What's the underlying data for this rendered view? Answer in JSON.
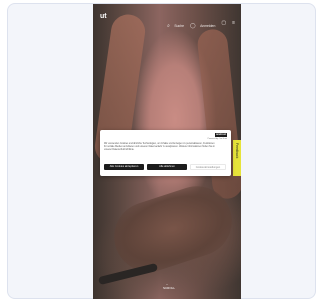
{
  "header": {
    "logo_text": "ut",
    "nav": [
      {
        "icon": "search-icon",
        "glyph": "⌕",
        "label": "Suche"
      },
      {
        "icon": "user-icon",
        "glyph": "◯",
        "label": "Anmelden"
      },
      {
        "icon": "cart-icon",
        "glyph": "▢",
        "label": ""
      },
      {
        "icon": "menu-icon",
        "glyph": "≡",
        "label": ""
      }
    ]
  },
  "side_tab": {
    "label": "Feedback"
  },
  "cookie_dialog": {
    "badge": "onetrust",
    "sub": "Powered by OneTrust",
    "text": "Wir verwenden Cookies und ähnliche Technologien, um Inhalte und Anzeigen zu personalisieren, Funktionen für soziale Medien anzubieten und unseren Datenverkehr zu analysieren. Weitere Informationen finden Sie in unserer Datenschutzrichtlinie.",
    "accept_label": "Alle Cookies akzeptieren",
    "reject_label": "Alle ablehnen",
    "settings_label": "Cookie-Einstellungen"
  },
  "scroll_hint": "SCROLL",
  "colors": {
    "accent": "#e6e33a",
    "dark": "#1c1c1c"
  }
}
